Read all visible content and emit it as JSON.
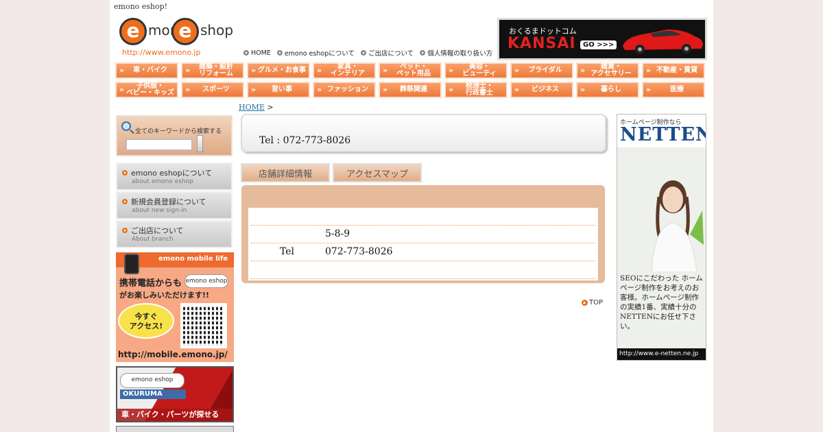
{
  "header": {
    "site_name": "emono eshop!",
    "logo": {
      "part1": "mono",
      "part2": "shop",
      "url": "http://www.emono.jp"
    },
    "nav": [
      {
        "label": "HOME"
      },
      {
        "label": "emono eshopについて"
      },
      {
        "label": "ご出店について"
      },
      {
        "label": "個人情報の取り扱い方"
      }
    ],
    "banner": {
      "sub": "おくるまドットコム",
      "title": "KANSAI",
      "go": "GO >>>"
    }
  },
  "categories": [
    "車・バイク",
    "建築・設計\nリフォーム",
    "グルメ・お食事",
    "家具・\nインテリア",
    "ペット・\nペット用品",
    "美容・\nビューティ",
    "ブライダル",
    "雑貨・\nアクセサリー",
    "不動産・賃貸",
    "子供服・\nベビー・キッズ",
    "スポーツ",
    "習い事",
    "ファッション",
    "葬祭関連",
    "税理士・\n行政書士",
    "ビジネス",
    "暮らし",
    "医療"
  ],
  "breadcrumb": {
    "home": "HOME",
    "sep": ">"
  },
  "sidebar": {
    "search_label": "全てのキーワードから検索する",
    "search_placeholder": "",
    "menu": [
      {
        "title": "emono eshopについて",
        "sub": "about emono eshop"
      },
      {
        "title": "新規会員登録について",
        "sub": "about new sign-in"
      },
      {
        "title": "ご出店について",
        "sub": "About branch"
      }
    ],
    "mobile_banner": {
      "top": "emono mobile life",
      "line1": "携帯電話からも",
      "line2": "がお楽しみいただけます!!",
      "bubble": "今すぐ\nアクセス!",
      "url": "http://mobile.emono.jp/",
      "mini_logo": "emono eshop"
    },
    "okuruma_banner": {
      "logo": "emono eshop",
      "label": "OKURUMA",
      "caption": "車・バイク・パーツが探せる"
    }
  },
  "main": {
    "tel_line": "Tel : 072-773-8026",
    "tabs": [
      {
        "label": "店舗詳細情報"
      },
      {
        "label": "アクセスマップ"
      }
    ],
    "rows": [
      {
        "key": "",
        "value": ""
      },
      {
        "key": "",
        "value": "5-8-9"
      },
      {
        "key": "Tel",
        "value": "072-773-8026"
      },
      {
        "key": "",
        "value": ""
      }
    ],
    "top_link": "TOP"
  },
  "ad": {
    "sub": "ホームページ制作なら",
    "title": "NETTEN",
    "body": "SEOにこだわった ホームページ制作をお考えのお客様。ホームページ制作の実績1番、実績十分のNETTENにお任せ下さい。",
    "url": "http://www.e-netten.ne.jp"
  },
  "colors": {
    "accent": "#ee6e1e",
    "panel": "#e5bb9c",
    "link": "#1e6aa8",
    "ad_title": "#1b4d8a"
  }
}
